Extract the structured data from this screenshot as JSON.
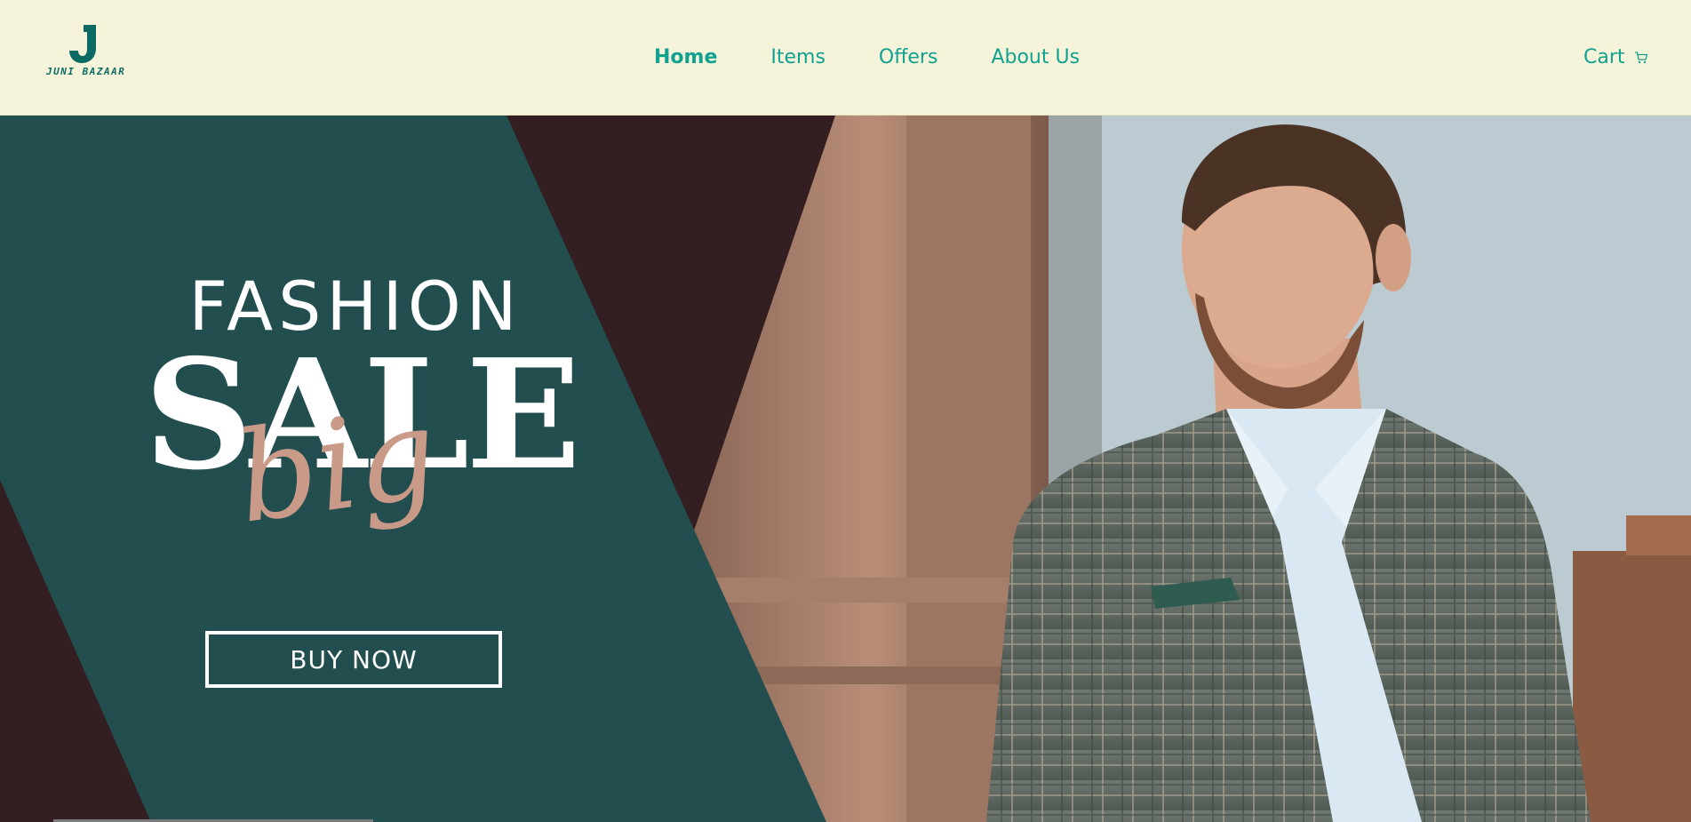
{
  "brand": {
    "logo_letter": "J",
    "name": "JUNI BAZAAR"
  },
  "nav": {
    "items": [
      {
        "label": "Home",
        "active": true
      },
      {
        "label": "Items",
        "active": false
      },
      {
        "label": "Offers",
        "active": false
      },
      {
        "label": "About Us",
        "active": false
      }
    ]
  },
  "cart": {
    "label": "Cart",
    "icon": "cart-icon"
  },
  "hero": {
    "line1": "FASHION",
    "line2": "SALE",
    "line3": "big",
    "cta_label": "BUY NOW"
  },
  "colors": {
    "header_bg": "#f5f4da",
    "accent": "#11a191",
    "panel_teal": "#234e4f",
    "panel_dark": "#331f21",
    "script_pink": "#c99a88"
  }
}
